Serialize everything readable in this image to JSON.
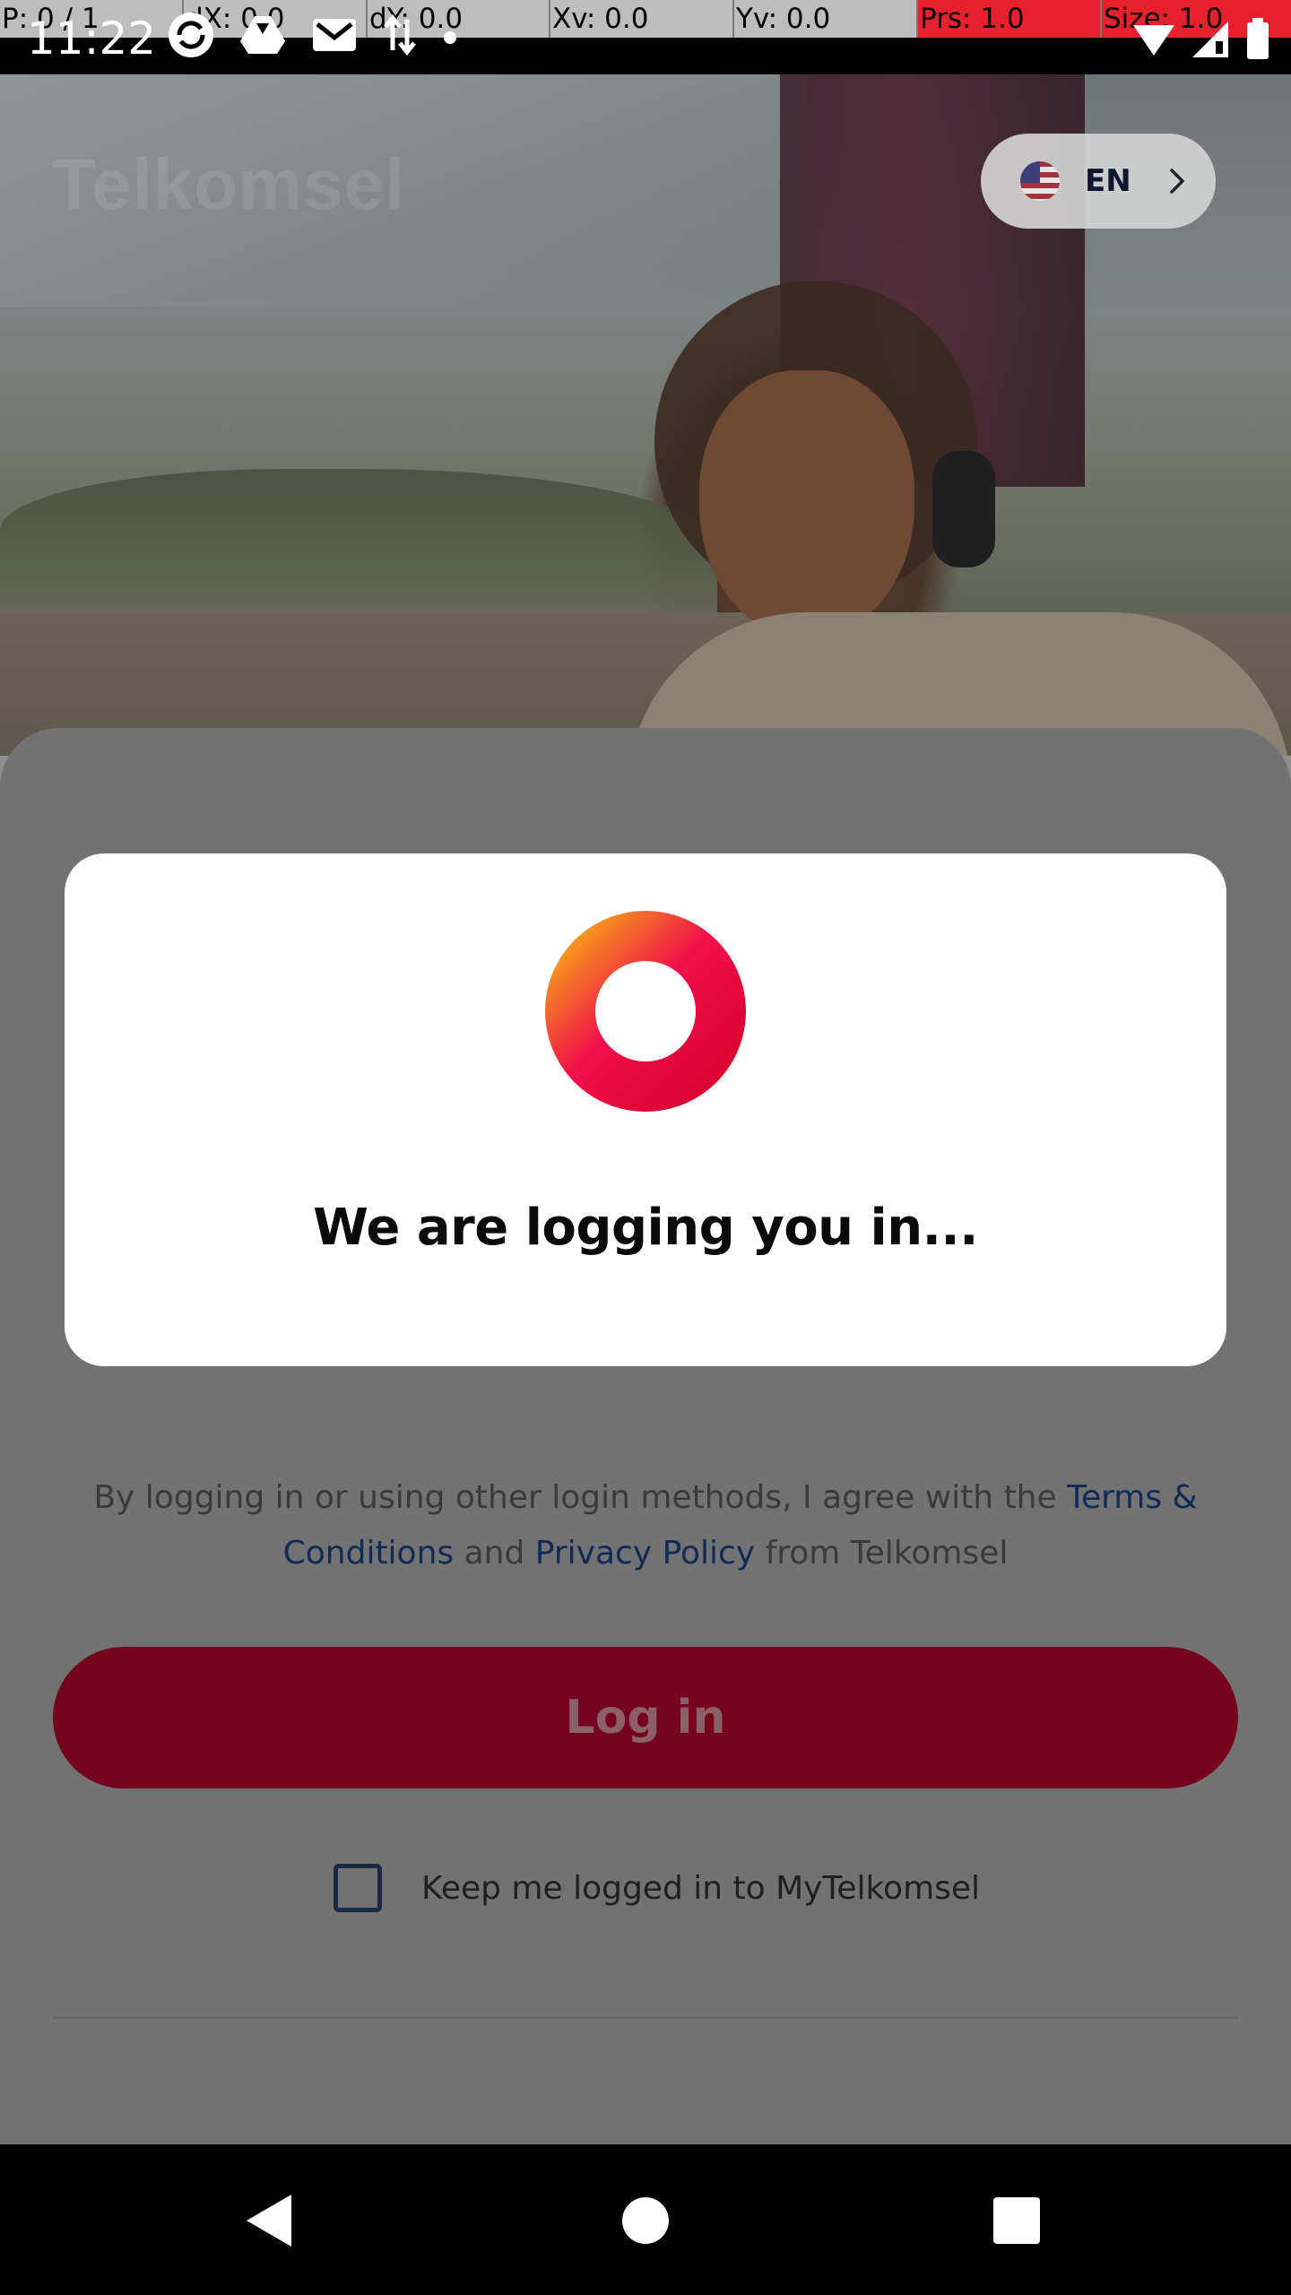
{
  "debug": {
    "pointer": "P: 0 / 1",
    "dx": "dX: 0.0",
    "dy": "dY: 0.0",
    "xv": "Xv: 0.0",
    "yv": "Yv: 0.0",
    "prs": "Prs: 1.0",
    "size": "Size: 1.0"
  },
  "status_bar": {
    "time": "11:22",
    "left_icons": [
      "sync-icon",
      "drive-icon",
      "gmail-icon",
      "data-transfer-icon",
      "dot-icon"
    ],
    "right_icons": [
      "wifi-icon",
      "signal-icon",
      "battery-icon"
    ]
  },
  "hero": {
    "brand": "Telkomsel",
    "language": {
      "code": "EN",
      "flag_icon": "us-flag-icon",
      "chevron_icon": "chevron-right-icon"
    }
  },
  "dialog": {
    "message": "We are logging you in...",
    "loader_icon": "loading-ring-icon",
    "ring_colors": [
      "#f7a01c",
      "#f0114a",
      "#d8022f"
    ]
  },
  "login_sheet": {
    "terms_prefix": "By logging in or using other login methods, I agree with the ",
    "terms_link": "Terms & Conditions",
    "terms_and": " and ",
    "privacy_link": "Privacy Policy",
    "terms_suffix": " from Telkomsel",
    "login_button": "Log in",
    "keep_logged_in_label": "Keep me logged in to MyTelkomsel",
    "keep_logged_in_checked": false
  },
  "nav_bar": {
    "back_icon": "back-triangle-icon",
    "home_icon": "home-circle-icon",
    "recents_icon": "recents-square-icon"
  },
  "colors": {
    "primary_dimmed": "#76041c",
    "link": "#0f2a55",
    "dialog_bg": "#ffffff"
  }
}
